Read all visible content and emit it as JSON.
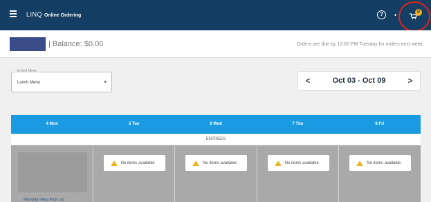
{
  "app": {
    "brand": "LINQ",
    "brand_sub": "Online Ordering",
    "help_symbol": "?",
    "user_symbol": "•",
    "cart_count": "0",
    "accent_color": "#143e63",
    "day_bar_color": "#1a9ae0"
  },
  "header": {
    "balance": "| Balance: $0.00",
    "due_note": "Orders are due by 12:00 PM Tuesday for orders next week."
  },
  "menu_select": {
    "legend": "School Menu",
    "value": "Lunch Menu"
  },
  "week_nav": {
    "prev": "<",
    "range": "Oct 03 - Oct 09",
    "next": ">"
  },
  "days": [
    "4 Mon",
    "5 Tue",
    "6 Wed",
    "7 Thu",
    "8 Fri"
  ],
  "section": "ENTREES",
  "items": {
    "mon_label": "Monday Meal Pick Up",
    "not_available": "No items available"
  }
}
